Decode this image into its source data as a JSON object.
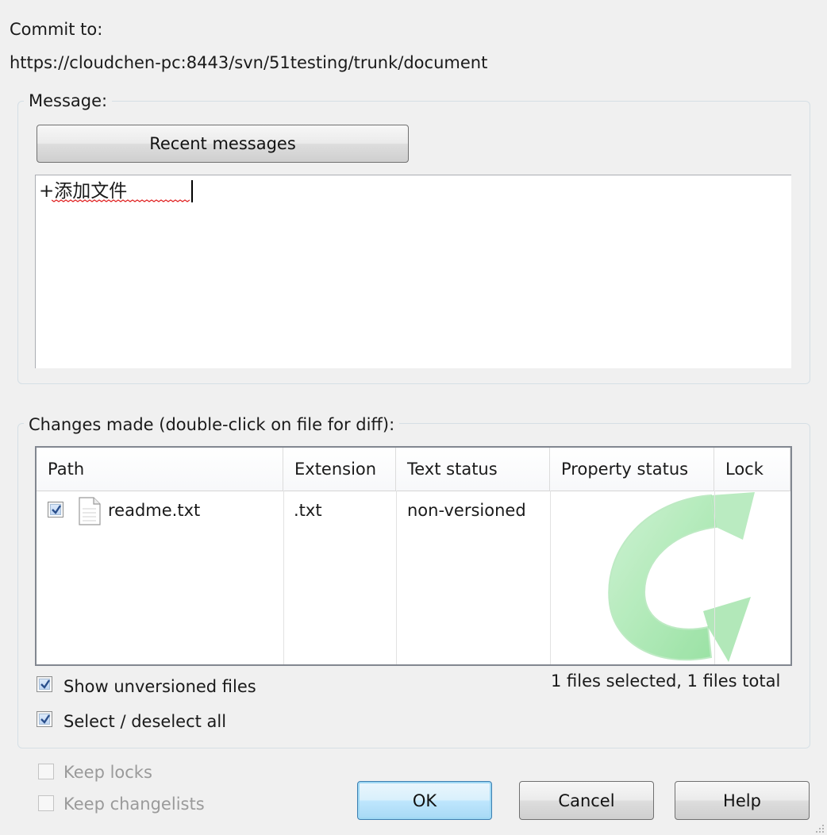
{
  "dialog": {
    "commit_to_label": "Commit to:",
    "commit_url": "https://cloudchen-pc:8443/svn/51testing/trunk/document"
  },
  "message": {
    "group_title": "Message:",
    "recent_button": "Recent messages",
    "text": "+添加文件"
  },
  "changes": {
    "group_title": "Changes made (double-click on file for diff):",
    "columns": [
      "Path",
      "Extension",
      "Text status",
      "Property status",
      "Lock"
    ],
    "rows": [
      {
        "checked": true,
        "path": "readme.txt",
        "extension": ".txt",
        "text_status": "non-versioned",
        "property_status": "",
        "lock": ""
      }
    ],
    "show_unversioned": {
      "label": "Show unversioned files",
      "checked": true
    },
    "select_all": {
      "label": "Select / deselect all",
      "checked": true
    },
    "summary": "1 files selected, 1 files total"
  },
  "options": {
    "keep_locks": {
      "label": "Keep locks",
      "checked": false,
      "enabled": false
    },
    "keep_changelists": {
      "label": "Keep changelists",
      "checked": false,
      "enabled": false
    }
  },
  "buttons": {
    "ok": "OK",
    "cancel": "Cancel",
    "help": "Help"
  },
  "colors": {
    "accent": "#3c7fb1",
    "watermark": "#7ddc8a",
    "check": "#2a4f8c"
  }
}
